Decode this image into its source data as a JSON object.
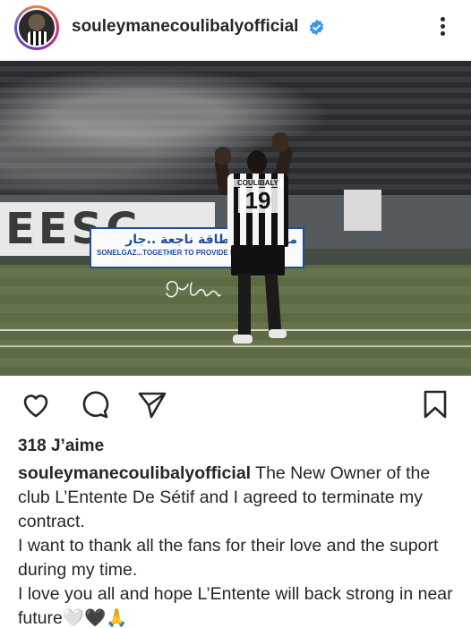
{
  "header": {
    "username": "souleymanecoulibalyofficial",
    "verified_icon": "verified-badge-icon",
    "more_icon": "more-options-icon",
    "accent_color": "#3897f0"
  },
  "photo": {
    "ad_arabic": "معا لتوفير طاقة ناجعة ..جار",
    "ad_english": "SONELGAZ...TOGETHER TO PROVIDE EFFICIENT",
    "banner_text": "EESC",
    "player_name": "COULIBALY",
    "player_number": "19"
  },
  "actions": {
    "like_icon": "heart-icon",
    "comment_icon": "comment-icon",
    "share_icon": "send-icon",
    "save_icon": "bookmark-icon"
  },
  "likes": "318 J’aime",
  "caption": {
    "username": "souleymanecoulibalyofficial",
    "line1": " The New Owner of the club L’Entente De Sétif and I agreed to terminate my contract.",
    "line2": "I want to thank all the fans for their love and the suport during my time.",
    "line3": "I love you all and hope L’Entente will back strong in near future🤍🖤🙏"
  }
}
